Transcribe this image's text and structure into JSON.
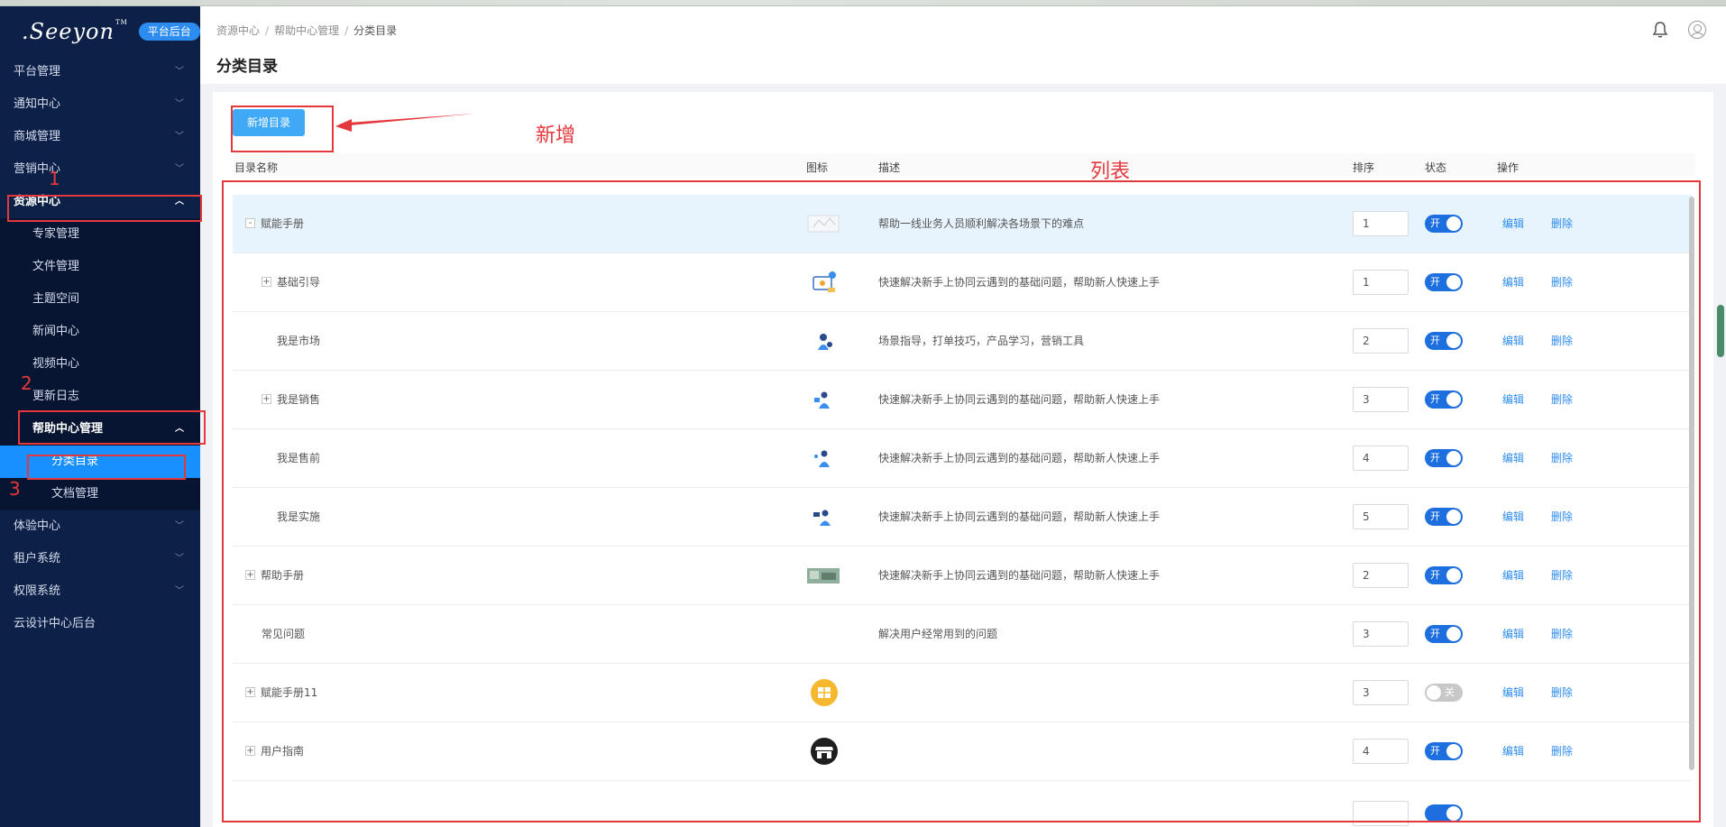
{
  "brand": {
    "logo": ".Seeyon",
    "tm": "TM",
    "badge": "平台后台"
  },
  "sidebar": {
    "items": [
      {
        "label": "平台管理"
      },
      {
        "label": "通知中心"
      },
      {
        "label": "商城管理"
      },
      {
        "label": "营销中心"
      },
      {
        "label": "资源中心"
      },
      {
        "label": "专家管理"
      },
      {
        "label": "文件管理"
      },
      {
        "label": "主题空间"
      },
      {
        "label": "新闻中心"
      },
      {
        "label": "视频中心"
      },
      {
        "label": "更新日志"
      },
      {
        "label": "帮助中心管理"
      },
      {
        "label": "分类目录"
      },
      {
        "label": "文档管理"
      },
      {
        "label": "体验中心"
      },
      {
        "label": "租户系统"
      },
      {
        "label": "权限系统"
      },
      {
        "label": "云设计中心后台"
      }
    ]
  },
  "header": {
    "breadcrumb": [
      "资源中心",
      "帮助中心管理",
      "分类目录"
    ],
    "title": "分类目录"
  },
  "toolbar": {
    "add_label": "新增目录"
  },
  "table": {
    "columns": [
      "目录名称",
      "图标",
      "描述",
      "排序",
      "状态",
      "操作"
    ],
    "edit_label": "编辑",
    "delete_label": "删除",
    "rows": [
      {
        "name": "赋能手册",
        "expander": "-",
        "desc": "帮助一线业务人员顺利解决各场景下的难点",
        "sort": "1",
        "status": "开"
      },
      {
        "name": "基础引导",
        "expander": "+",
        "desc": "快速解决新手上协同云遇到的基础问题，帮助新人快速上手",
        "sort": "1",
        "status": "开"
      },
      {
        "name": "我是市场",
        "expander": "",
        "desc": "场景指导，打单技巧，产品学习，营销工具",
        "sort": "2",
        "status": "开"
      },
      {
        "name": "我是销售",
        "expander": "+",
        "desc": "快速解决新手上协同云遇到的基础问题，帮助新人快速上手",
        "sort": "3",
        "status": "开"
      },
      {
        "name": "我是售前",
        "expander": "",
        "desc": "快速解决新手上协同云遇到的基础问题，帮助新人快速上手",
        "sort": "4",
        "status": "开"
      },
      {
        "name": "我是实施",
        "expander": "",
        "desc": "快速解决新手上协同云遇到的基础问题，帮助新人快速上手",
        "sort": "5",
        "status": "开"
      },
      {
        "name": "帮助手册",
        "expander": "+",
        "desc": "快速解决新手上协同云遇到的基础问题，帮助新人快速上手",
        "sort": "2",
        "status": "开"
      },
      {
        "name": "常见问题",
        "expander": "",
        "desc": "解决用户经常用到的问题",
        "sort": "3",
        "status": "开"
      },
      {
        "name": "赋能手册11",
        "expander": "+",
        "desc": "",
        "sort": "3",
        "status": "关"
      },
      {
        "name": "用户指南",
        "expander": "+",
        "desc": "",
        "sort": "4",
        "status": "开"
      }
    ]
  },
  "annotations": {
    "add": "新增",
    "list": "列表",
    "n1": "1",
    "n2": "2",
    "n3": "3"
  },
  "colors": {
    "sidebar_bg": "#0d2148",
    "accent": "#1890ff",
    "annotation": "#e4383c"
  }
}
